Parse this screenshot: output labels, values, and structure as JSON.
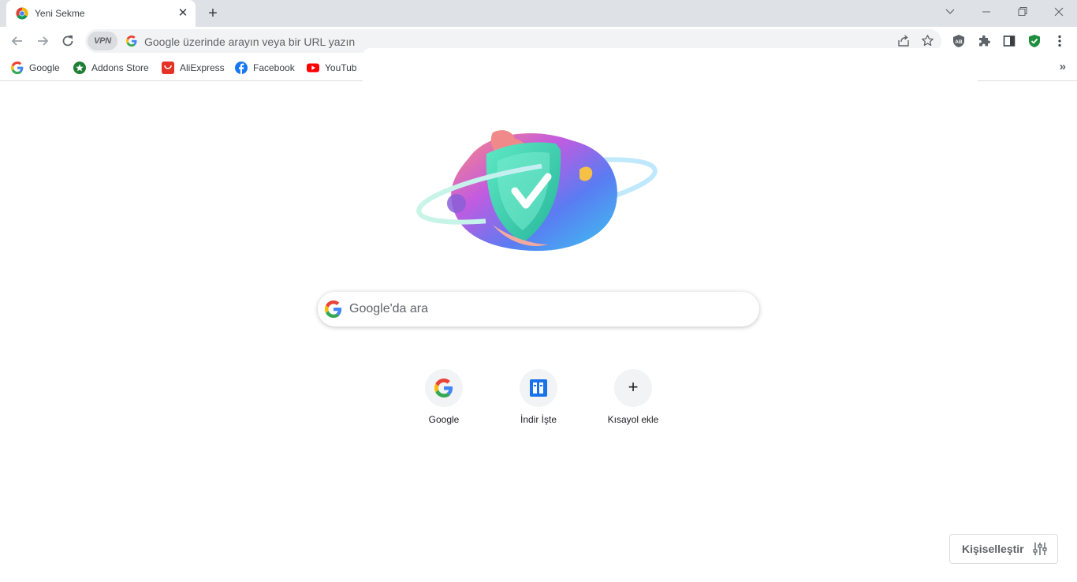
{
  "tab": {
    "title": "Yeni Sekme",
    "favicon": "chrome-icon"
  },
  "window": {
    "minimize": "minimize-icon",
    "restore": "restore-icon",
    "close": "close-icon"
  },
  "omnibox": {
    "vpn_label": "VPN",
    "placeholder": "Google üzerinde arayın veya bir URL yazın"
  },
  "bookmarks": [
    {
      "label": "Google",
      "icon": "google-icon"
    },
    {
      "label": "Addons Store",
      "icon": "addons-store-icon"
    },
    {
      "label": "AliExpress",
      "icon": "aliexpress-icon"
    },
    {
      "label": "Facebook",
      "icon": "facebook-icon"
    },
    {
      "label": "YouTub",
      "icon": "youtube-icon"
    }
  ],
  "search": {
    "placeholder": "Google'da ara"
  },
  "shortcuts": [
    {
      "label": "Google",
      "icon": "google-icon"
    },
    {
      "label": "İndir İşte",
      "icon": "indir-iste-icon"
    },
    {
      "label": "Kısayol ekle",
      "icon": "add-icon"
    }
  ],
  "customize": {
    "label": "Kişiselleştir"
  },
  "colors": {
    "tabstrip": "#dee1e6",
    "omnibox": "#f1f3f4",
    "google_blue": "#4285f4",
    "google_red": "#ea4335",
    "google_yellow": "#fbbc05",
    "google_green": "#34a853",
    "shield_green": "#1e8e3e"
  }
}
